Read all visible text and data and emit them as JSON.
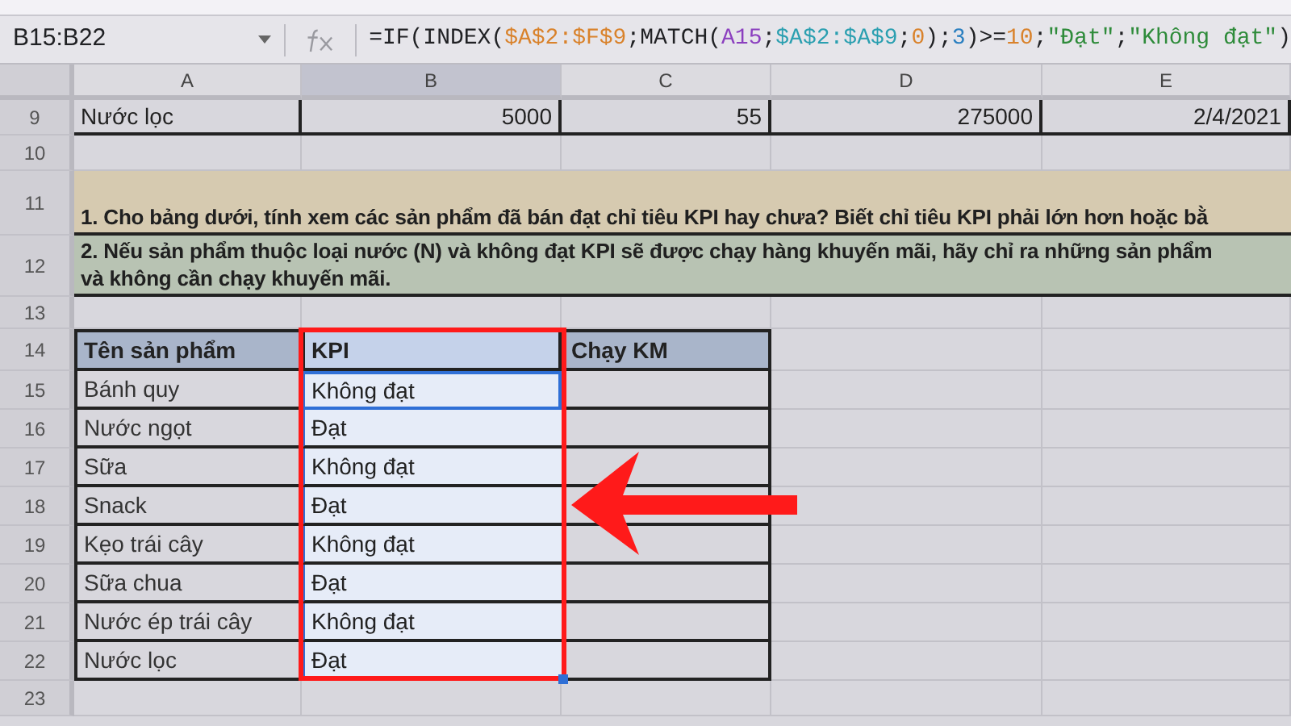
{
  "name_box": "B15:B22",
  "formula": [
    {
      "text": "=IF(INDEX(",
      "color": "#202124"
    },
    {
      "text": "$A$2:$F$9",
      "color": "#d9822b"
    },
    {
      "text": ";MATCH(",
      "color": "#202124"
    },
    {
      "text": "A15",
      "color": "#8b3fbf"
    },
    {
      "text": ";",
      "color": "#202124"
    },
    {
      "text": "$A$2:$A$9",
      "color": "#2a9fb0"
    },
    {
      "text": ";",
      "color": "#202124"
    },
    {
      "text": "0",
      "color": "#d9822b"
    },
    {
      "text": ");",
      "color": "#202124"
    },
    {
      "text": "3",
      "color": "#2a7fc0"
    },
    {
      "text": ")>=",
      "color": "#202124"
    },
    {
      "text": "10",
      "color": "#d9822b"
    },
    {
      "text": ";",
      "color": "#202124"
    },
    {
      "text": "\"Đạt\"",
      "color": "#2e8b3a"
    },
    {
      "text": ";",
      "color": "#202124"
    },
    {
      "text": "\"Không đạt\"",
      "color": "#2e8b3a"
    },
    {
      "text": ")",
      "color": "#202124"
    }
  ],
  "columns": [
    {
      "label": "A",
      "selected": false
    },
    {
      "label": "B",
      "selected": true
    },
    {
      "label": "C",
      "selected": false
    },
    {
      "label": "D",
      "selected": false
    },
    {
      "label": "E",
      "selected": false
    }
  ],
  "rows": [
    {
      "kind": "data",
      "number": "9",
      "cells": [
        "Nước lọc",
        "5000",
        "55",
        "275000",
        "2/4/2021"
      ]
    },
    {
      "kind": "blank",
      "number": "10"
    },
    {
      "kind": "note",
      "number": "11",
      "color": "#d6cab0",
      "lines": [
        "1. Cho bảng dưới, tính xem các sản phẩm đã bán đạt chỉ tiêu KPI hay chưa? Biết chỉ tiêu KPI phải lớn hơn hoặc bằ"
      ]
    },
    {
      "kind": "note",
      "number": "12",
      "color": "#b8c3b3",
      "lines": [
        "2. Nếu sản phẩm thuộc loại nước (N) và không đạt KPI sẽ được chạy hàng khuyến mãi, hãy chỉ ra những sản phẩm",
        "và không cần chạy khuyến mãi."
      ]
    },
    {
      "kind": "blank",
      "number": "13"
    },
    {
      "kind": "table_header",
      "number": "14",
      "cells": [
        "Tên sản phẩm",
        "KPI",
        "Chạy KM"
      ]
    },
    {
      "kind": "table",
      "number": "15",
      "active": true,
      "cells": [
        "Bánh quy",
        "Không đạt"
      ]
    },
    {
      "kind": "table",
      "number": "16",
      "active": false,
      "cells": [
        "Nước ngọt",
        "Đạt"
      ]
    },
    {
      "kind": "table",
      "number": "17",
      "active": false,
      "cells": [
        "Sữa",
        "Không đạt"
      ]
    },
    {
      "kind": "table",
      "number": "18",
      "active": false,
      "cells": [
        "Snack",
        "Đạt"
      ]
    },
    {
      "kind": "table",
      "number": "19",
      "active": false,
      "cells": [
        "Kẹo trái cây",
        "Không đạt"
      ]
    },
    {
      "kind": "table",
      "number": "20",
      "active": false,
      "cells": [
        "Sữa chua",
        "Đạt"
      ]
    },
    {
      "kind": "table",
      "number": "21",
      "active": false,
      "cells": [
        "Nước ép trái cây",
        "Không đạt"
      ]
    },
    {
      "kind": "table",
      "number": "22",
      "active": false,
      "cells": [
        "Nước lọc",
        "Đạt"
      ]
    },
    {
      "kind": "blank",
      "number": "23"
    }
  ]
}
